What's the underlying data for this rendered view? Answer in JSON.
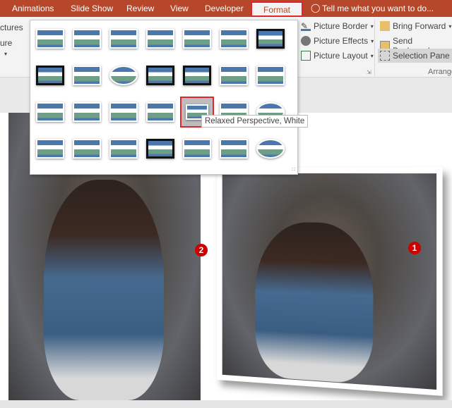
{
  "tabs": [
    {
      "label": "Animations"
    },
    {
      "label": "Slide Show"
    },
    {
      "label": "Review"
    },
    {
      "label": "View"
    },
    {
      "label": "Developer"
    },
    {
      "label": "Format",
      "active": true
    }
  ],
  "tell_me": "Tell me what you want to do...",
  "ribbon": {
    "left_partial": [
      "ctures",
      "ure"
    ],
    "picture_border": "Picture Border",
    "picture_effects": "Picture Effects",
    "picture_layout": "Picture Layout",
    "bring_forward": "Bring Forward",
    "send_backward": "Send Backward",
    "selection_pane": "Selection Pane",
    "arrange_group": "Arrange"
  },
  "gallery": {
    "rows": 4,
    "cols": 7,
    "selected_index": 18,
    "tooltip": "Relaxed Perspective, White"
  },
  "badges": {
    "left": "2",
    "right": "1"
  },
  "colors": {
    "accent": "#b7472a",
    "highlight": "#e0262a",
    "badge": "#cc0000",
    "thumb_sky": "#4a78ad",
    "thumb_land": "#6f9e86"
  }
}
